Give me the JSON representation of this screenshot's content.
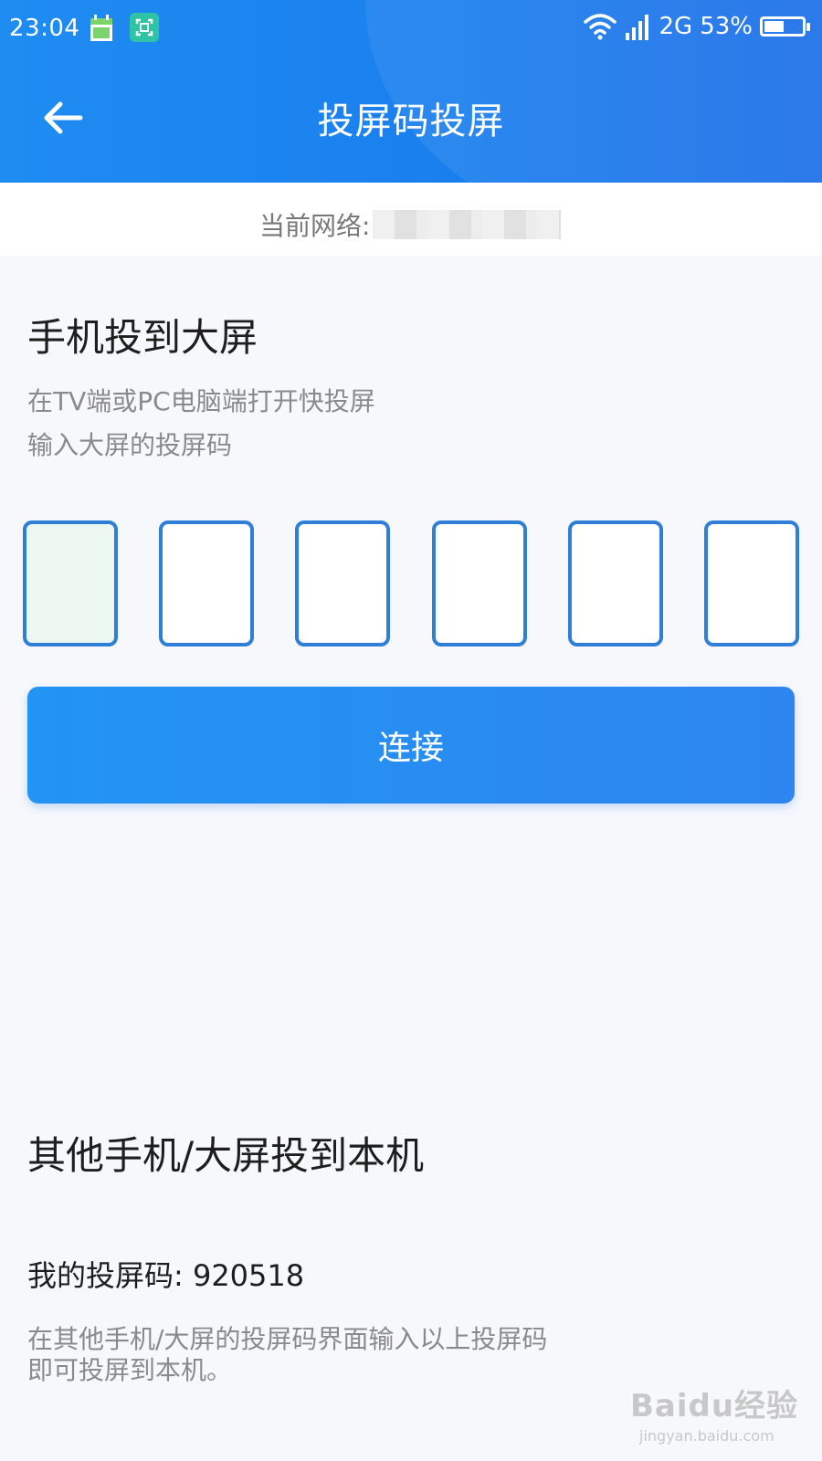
{
  "status_bar": {
    "time": "23:04",
    "network_type": "2G",
    "battery": "53%",
    "battery_level": 0.53
  },
  "header": {
    "title": "投屏码投屏",
    "back_icon": "arrow-left-icon"
  },
  "network": {
    "label": "当前网络:"
  },
  "cast_to_screen": {
    "title": "手机投到大屏",
    "desc_line1": "在TV端或PC电脑端打开快投屏",
    "desc_line2": "输入大屏的投屏码",
    "code_boxes": [
      "",
      "",
      "",
      "",
      "",
      ""
    ],
    "connect_label": "连接"
  },
  "cast_to_me": {
    "title": "其他手机/大屏投到本机",
    "my_code": "我的投屏码: 920518",
    "desc_line1": "在其他手机/大屏的投屏码界面输入以上投屏码",
    "desc_line2": "即可投屏到本机。"
  },
  "watermark": {
    "line1": "Baidu经验",
    "line2": "jingyan.baidu.com"
  },
  "colors": {
    "header_blue": "#1a7fee",
    "accent_blue": "#2f7ed8",
    "button_blue": "#2294f4"
  }
}
